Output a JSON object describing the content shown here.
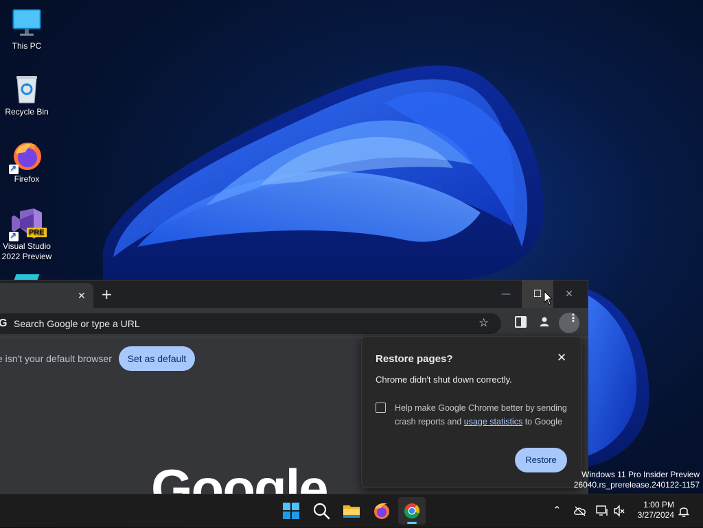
{
  "desktop": {
    "icons": [
      {
        "label": "This PC"
      },
      {
        "label": "Recycle Bin"
      },
      {
        "label": "Firefox"
      },
      {
        "label": "Visual Studio 2022 Preview",
        "badge": "PRE"
      }
    ],
    "watermark": {
      "line1": "Windows 11 Pro Insider Preview",
      "line2": "26040.rs_prerelease.240122-1157"
    }
  },
  "chrome": {
    "tab": {
      "close_glyph": "✕"
    },
    "new_tab_glyph": "+",
    "window_controls": {
      "minimize": "—",
      "maximize": "☐",
      "close": "✕"
    },
    "omnibox": {
      "placeholder": "Search Google or type a URL",
      "g_letter": "G"
    },
    "toolbar_icons": [
      "star-icon",
      "side-panel-icon",
      "profile-icon",
      "menu-icon"
    ],
    "infobar": {
      "text": "e isn't your default browser",
      "button": "Set as default"
    },
    "logo_text": "Google"
  },
  "restore_dialog": {
    "title": "Restore pages?",
    "message": "Chrome didn't shut down correctly.",
    "help_prefix": "Help make Google Chrome better by sending crash reports and ",
    "help_link": "usage statistics",
    "help_suffix": " to Google",
    "checkbox_checked": false,
    "button": "Restore",
    "close_glyph": "✕"
  },
  "taskbar": {
    "apps": [
      "start-icon",
      "search-icon",
      "file-explorer-icon",
      "firefox-icon",
      "chrome-icon"
    ],
    "active_app": "chrome-icon",
    "tray_icons": [
      "chevron-up-icon",
      "onedrive-icon",
      "network-icon",
      "volume-muted-icon",
      "notification-bell-icon"
    ],
    "time": "1:00 PM",
    "date": "3/27/2024"
  },
  "colors": {
    "accent": "#a8c7fa",
    "chrome_frame": "#202124",
    "chrome_toolbar": "#35363a",
    "taskbar": "#1c1c1c",
    "active_indicator": "#60cdff"
  }
}
